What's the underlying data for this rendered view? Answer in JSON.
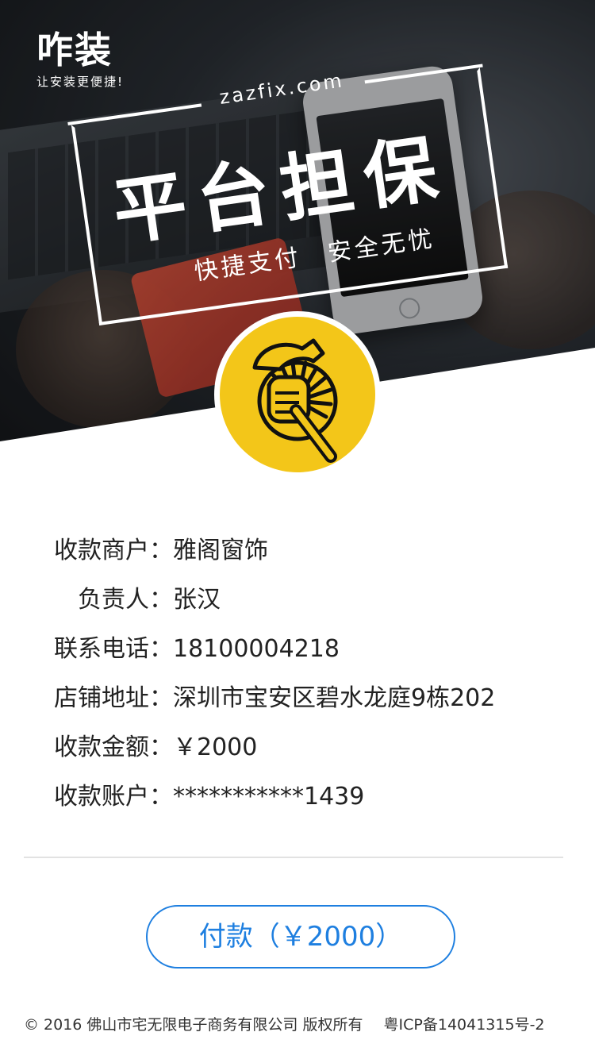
{
  "header": {
    "brand_name": "咋装",
    "brand_slogan": "让安装更便捷!",
    "domain": "zazfix.com",
    "title": "平台担保",
    "slogan": "快捷支付　安全无忧"
  },
  "merchant": {
    "rows": [
      {
        "label": "收款商户：",
        "value": "雅阁窗饰"
      },
      {
        "label": "负责人：",
        "value": "张汉"
      },
      {
        "label": "联系电话：",
        "value": "18100004218"
      },
      {
        "label": "店铺地址：",
        "value": "深圳市宝安区碧水龙庭9栋202"
      },
      {
        "label": "收款金额：",
        "value": "￥2000"
      },
      {
        "label": "收款账户：",
        "value": "***********1439"
      }
    ]
  },
  "pay_button": {
    "label": "付款（￥2000）"
  },
  "footer": {
    "copyright": "© 2016 佛山市宅无限电子商务有限公司 版权所有",
    "icp": "粤ICP备14041315号-2"
  },
  "colors": {
    "accent": "#1e7fe0",
    "badge": "#f3c619"
  },
  "icons": {
    "badge_icon": "hammer-fist-icon"
  }
}
